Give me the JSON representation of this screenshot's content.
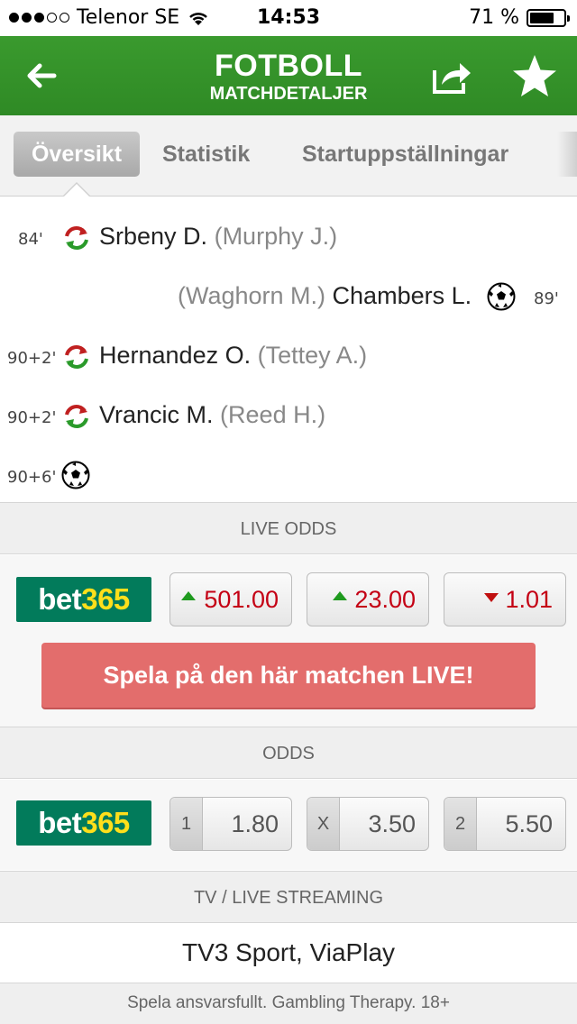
{
  "status_bar": {
    "carrier": "Telenor SE",
    "time": "14:53",
    "battery_text": "71 %",
    "battery_level": 0.71,
    "signal_bars": 3,
    "signal_total": 5
  },
  "header": {
    "title": "FOTBOLL",
    "subtitle": "MATCHDETALJER",
    "background_color": "#3a9a2e"
  },
  "tabs": [
    {
      "label": "Översikt",
      "active": true
    },
    {
      "label": "Statistik",
      "active": false
    },
    {
      "label": "Startuppställningar",
      "active": false
    }
  ],
  "events": [
    {
      "minute": "84'",
      "side": "home",
      "type": "substitution",
      "player_in": "Srbeny D.",
      "player_out": "(Murphy J.)"
    },
    {
      "minute": "89'",
      "side": "away",
      "type": "goal",
      "player": "Chambers L.",
      "assist": "(Waghorn M.)"
    },
    {
      "minute": "90+2'",
      "side": "home",
      "type": "substitution",
      "player_in": "Hernandez O.",
      "player_out": "(Tettey A.)"
    },
    {
      "minute": "90+2'",
      "side": "home",
      "type": "substitution",
      "player_in": "Vrancic M.",
      "player_out": "(Reed H.)"
    },
    {
      "minute": "90+6'",
      "side": "home",
      "type": "goal"
    }
  ],
  "live_odds": {
    "heading": "LIVE ODDS",
    "bookmaker": {
      "part1": "bet",
      "part2": "365"
    },
    "odds": [
      {
        "value": "501.00",
        "trend": "up"
      },
      {
        "value": "23.00",
        "trend": "up"
      },
      {
        "value": "1.01",
        "trend": "down"
      }
    ],
    "cta": "Spela på den här matchen LIVE!"
  },
  "odds": {
    "heading": "ODDS",
    "bookmaker": {
      "part1": "bet",
      "part2": "365"
    },
    "odds": [
      {
        "label": "1",
        "value": "1.80"
      },
      {
        "label": "X",
        "value": "3.50"
      },
      {
        "label": "2",
        "value": "5.50"
      }
    ]
  },
  "tv": {
    "heading": "TV / LIVE STREAMING",
    "channels": "TV3 Sport, ViaPlay"
  },
  "footer": "Spela ansvarsfullt. Gambling Therapy. 18+"
}
